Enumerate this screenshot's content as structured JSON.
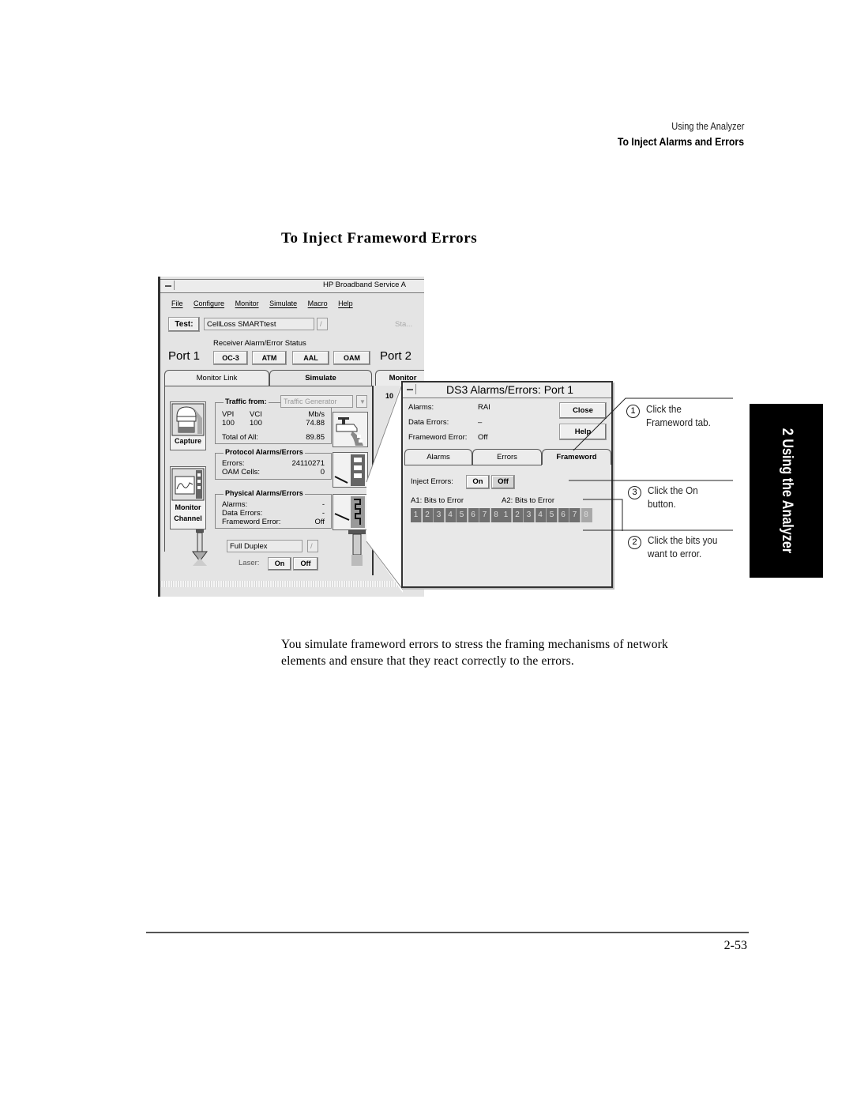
{
  "header": {
    "chapter": "Using the Analyzer",
    "section": "To Inject Alarms and Errors"
  },
  "section_title": "To Inject Frameword Errors",
  "side_tab": "2  Using the Analyzer",
  "app_window": {
    "title": "HP Broadband Service A",
    "menu": [
      "File",
      "Configure",
      "Monitor",
      "Simulate",
      "Macro",
      "Help"
    ],
    "test_label": "Test:",
    "test_value": "CellLoss SMARTtest",
    "start_label": "Sta...",
    "receiver_status_label": "Receiver Alarm/Error Status",
    "port1": "Port 1",
    "port2": "Port 2",
    "status_buttons": [
      "OC-3",
      "ATM",
      "AAL",
      "OAM"
    ],
    "tabs": [
      "Monitor Link",
      "Simulate",
      "Monitor"
    ],
    "active_tab": "Simulate",
    "capture_label": "Capture",
    "monitor_channel_label": [
      "Monitor",
      "Channel"
    ],
    "traffic": {
      "label": "Traffic from:",
      "value": "Traffic Generator",
      "headers": [
        "VPI",
        "VCI",
        "Mb/s"
      ],
      "row": [
        "100",
        "100",
        "74.88"
      ],
      "total_label": "Total of All:",
      "total_value": "89.85"
    },
    "protocol": {
      "title": "Protocol Alarms/Errors",
      "rows": [
        {
          "label": "Errors:",
          "value": "24110271"
        },
        {
          "label": "OAM Cells:",
          "value": "0"
        }
      ]
    },
    "physical": {
      "title": "Physical Alarms/Errors",
      "rows": [
        {
          "label": "Alarms:",
          "value": "-"
        },
        {
          "label": "Data Errors:",
          "value": "-"
        },
        {
          "label": "Frameword Error:",
          "value": "Off"
        }
      ]
    },
    "duplex_value": "Full Duplex",
    "laser_label": "Laser:",
    "laser_on": "On",
    "laser_off": "Off",
    "side_value": "10"
  },
  "dialog": {
    "title": "DS3 Alarms/Errors: Port 1",
    "status": [
      {
        "label": "Alarms:",
        "value": "RAI"
      },
      {
        "label": "Data Errors:",
        "value": "–"
      },
      {
        "label": "Frameword Error:",
        "value": "Off"
      }
    ],
    "close_label": "Close",
    "help_label": "Help",
    "tabs": [
      "Alarms",
      "Errors",
      "Frameword"
    ],
    "active_tab": "Frameword",
    "inject_label": "Inject Errors:",
    "inject_on": "On",
    "inject_off": "Off",
    "a1_label": "A1: Bits to Error",
    "a2_label": "A2: Bits to Error",
    "a1_bits": [
      "1",
      "2",
      "3",
      "4",
      "5",
      "6",
      "7",
      "8"
    ],
    "a2_bits": [
      "1",
      "2",
      "3",
      "4",
      "5",
      "6",
      "7",
      "8"
    ],
    "a2_selected_bit": "8"
  },
  "callouts": [
    {
      "num": "1",
      "text_line1": "Click the",
      "text_line2": "Frameword tab."
    },
    {
      "num": "3",
      "text_line1": "Click the On",
      "text_line2": "button."
    },
    {
      "num": "2",
      "text_line1": "Click the bits you",
      "text_line2": "want to error."
    }
  ],
  "body_text": "You simulate frameword errors to stress the framing mechanisms of network elements and ensure that they react correctly to the errors.",
  "page_number": "2-53"
}
